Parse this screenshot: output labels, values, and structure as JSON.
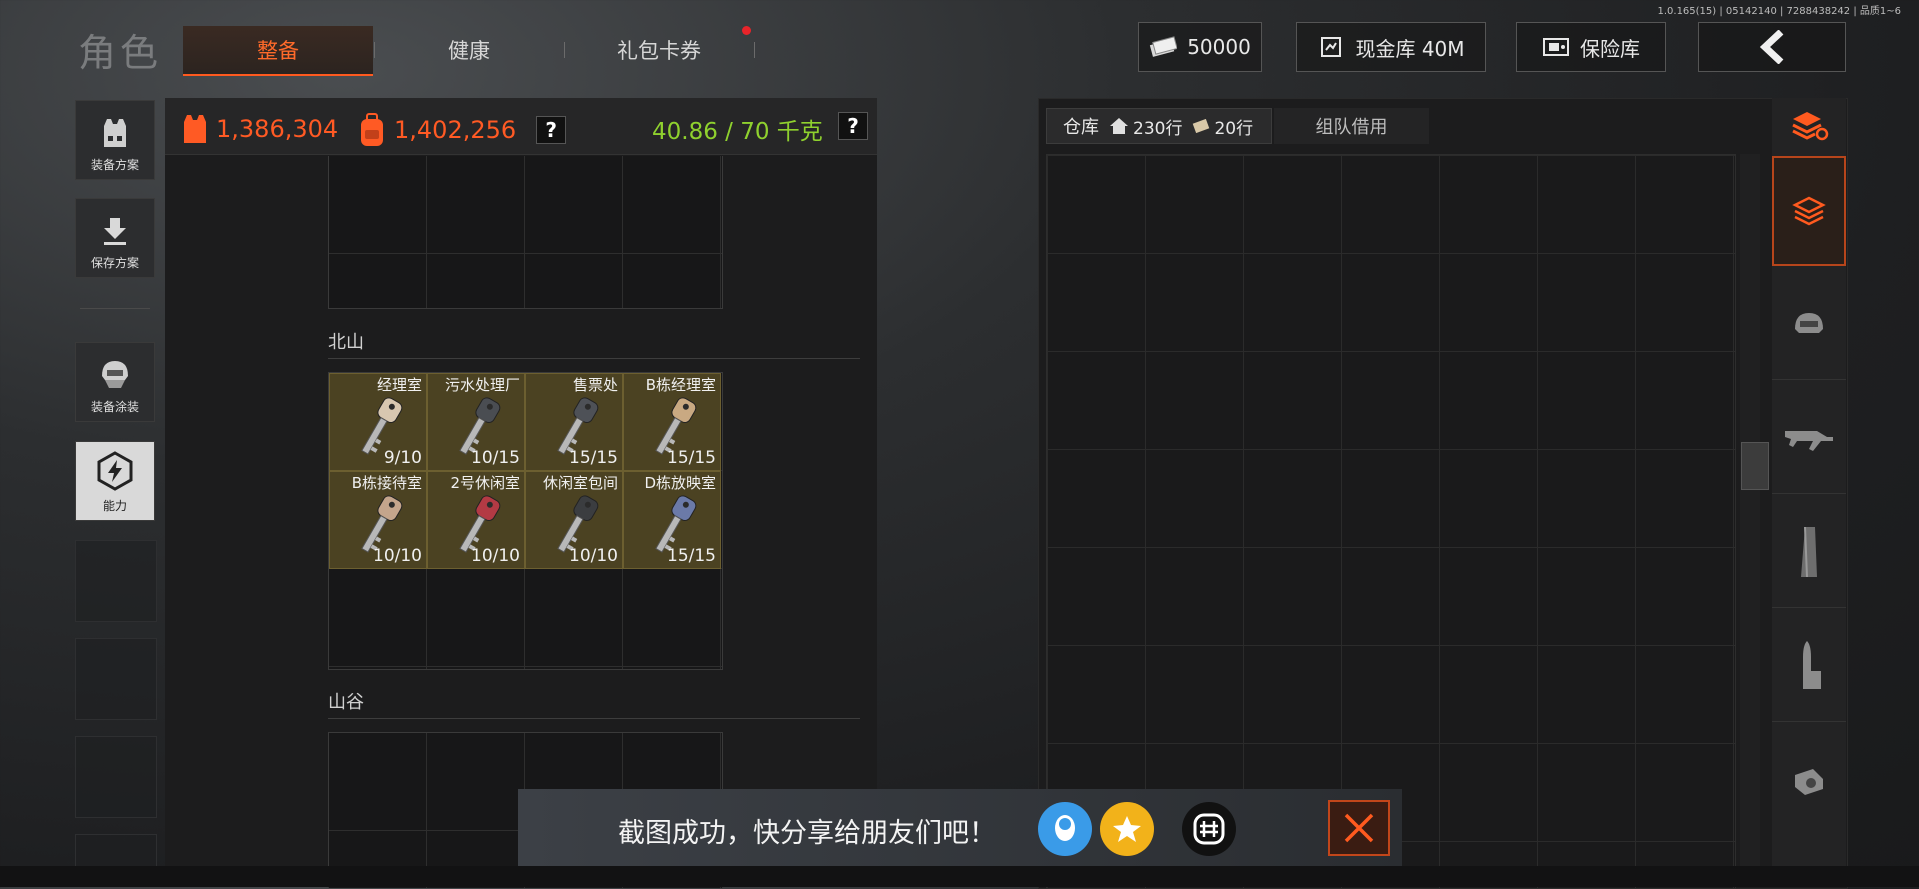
{
  "version": "1.0.165(15) | 05142140 | 7288438242 | 品质1~6",
  "header": {
    "title": "角色",
    "tabs": [
      {
        "label": "整备",
        "active": true
      },
      {
        "label": "健康",
        "active": false
      },
      {
        "label": "礼包卡券",
        "active": false,
        "badge": true
      }
    ],
    "currency": "50000",
    "cash_vault": "现金库 40M",
    "safe": "保险库"
  },
  "sidebar": [
    {
      "label": "装备方案",
      "icon": "vest-icon"
    },
    {
      "label": "保存方案",
      "icon": "download-icon"
    },
    {
      "label": "装备涂装",
      "icon": "helmet-icon"
    },
    {
      "label": "能力",
      "icon": "lightning-icon",
      "active": true
    }
  ],
  "stats": {
    "value_a": "1,386,304",
    "value_b": "1,402,256",
    "weight": "40.86 / 70 千克",
    "help": "?"
  },
  "sections": {
    "beishan": "北山",
    "shangu": "山谷"
  },
  "keys": [
    {
      "name": "经理室",
      "count": "9/10",
      "color": "#d8c7b0"
    },
    {
      "name": "污水处理厂",
      "count": "10/15",
      "color": "#4a4d52"
    },
    {
      "name": "售票处",
      "count": "15/15",
      "color": "#4e5157"
    },
    {
      "name": "B栋经理室",
      "count": "15/15",
      "color": "#c9a982"
    },
    {
      "name": "B栋接待室",
      "count": "10/10",
      "color": "#c4a58c"
    },
    {
      "name": "2号休闲室",
      "count": "10/10",
      "color": "#b33a44"
    },
    {
      "name": "休闲室包间",
      "count": "10/10",
      "color": "#3b3d40"
    },
    {
      "name": "D栋放映室",
      "count": "15/15",
      "color": "#6b7aa8"
    }
  ],
  "warehouse": {
    "tab": "仓库",
    "rows_a": "230行",
    "rows_b": "20行",
    "team_tab": "组队借用"
  },
  "categories": [
    "layers-icon",
    "helmet-icon",
    "rifle-icon",
    "magazine-icon",
    "ammo-icon",
    "scope-icon"
  ],
  "toast": {
    "text": "截图成功，快分享给朋友们吧！"
  },
  "colors": {
    "accent": "#ff5a1f",
    "weight_green": "#8fd12e",
    "key_bg": "#4b4222"
  }
}
